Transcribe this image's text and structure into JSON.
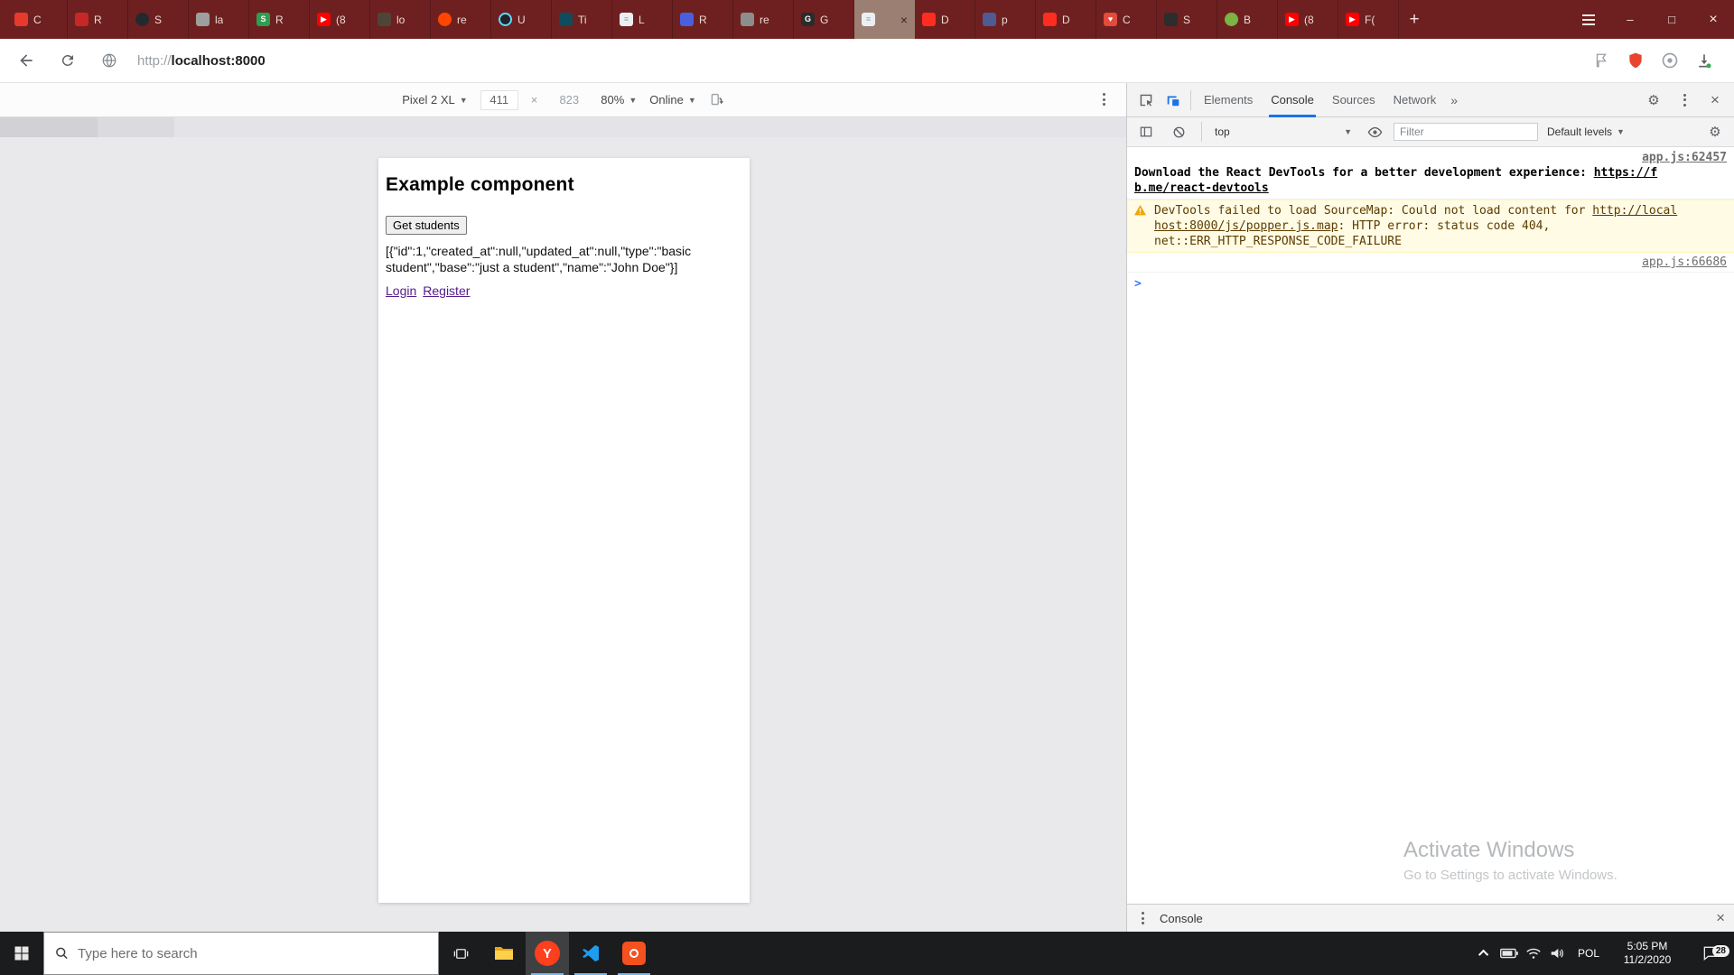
{
  "browser": {
    "new_tab": "+",
    "window": {
      "minimize": "–",
      "maximize": "□",
      "close": "×"
    },
    "address": {
      "protocol": "http://",
      "host": "localhost:8000"
    },
    "tabs": [
      {
        "title": "C",
        "color": "#e8392e",
        "glyph": "",
        "shape": "square"
      },
      {
        "title": "R",
        "color": "#c62828",
        "glyph": "",
        "shape": "square"
      },
      {
        "title": "S",
        "color": "#24292e",
        "glyph": "",
        "shape": "circle"
      },
      {
        "title": "la",
        "color": "#9e9e9e",
        "glyph": "",
        "shape": "square"
      },
      {
        "title": "R",
        "color": "#2e9e4f",
        "glyph": "S",
        "shape": "square"
      },
      {
        "title": "(8",
        "color": "#ff0000",
        "glyph": "▶",
        "shape": "square"
      },
      {
        "title": "lo",
        "color": "#4e4539",
        "glyph": "",
        "shape": "square"
      },
      {
        "title": "re",
        "color": "#ff4500",
        "glyph": "",
        "shape": "circle"
      },
      {
        "title": "U",
        "color": "#20232a",
        "glyph": "",
        "shape": "circle",
        "ring": "#61dafb"
      },
      {
        "title": "Ti",
        "color": "#0f4c5c",
        "glyph": "",
        "shape": "square"
      },
      {
        "title": "L",
        "color": "#eceff1",
        "glyph": "≡",
        "shape": "square",
        "fg": "#90a4ae"
      },
      {
        "title": "R",
        "color": "#4a5fe0",
        "glyph": "",
        "shape": "square"
      },
      {
        "title": "re",
        "color": "#8d8d8d",
        "glyph": "",
        "shape": "square"
      },
      {
        "title": "G",
        "color": "#2b2b2b",
        "glyph": "G",
        "shape": "square"
      },
      {
        "title": "",
        "color": "#eceff1",
        "glyph": "≡",
        "shape": "square",
        "fg": "#90a4ae",
        "active": true
      },
      {
        "title": "D",
        "color": "#ff2d20",
        "glyph": "",
        "shape": "square"
      },
      {
        "title": "p",
        "color": "#4f5b93",
        "glyph": "",
        "shape": "square"
      },
      {
        "title": "D",
        "color": "#ff2d20",
        "glyph": "",
        "shape": "square"
      },
      {
        "title": "C",
        "color": "#e64a3b",
        "glyph": "♥",
        "shape": "square"
      },
      {
        "title": "S",
        "color": "#2d2d2d",
        "glyph": "",
        "shape": "square"
      },
      {
        "title": "B",
        "color": "#7cb342",
        "glyph": "",
        "shape": "circle"
      },
      {
        "title": "(8",
        "color": "#ff0000",
        "glyph": "▶",
        "shape": "square"
      },
      {
        "title": "F(",
        "color": "#ff0000",
        "glyph": "▶",
        "shape": "square"
      }
    ]
  },
  "device_toolbar": {
    "device": "Pixel 2 XL",
    "width": "411",
    "sep": "×",
    "height": "823",
    "zoom": "80%",
    "throttle": "Online"
  },
  "page": {
    "heading": "Example component",
    "button_label": "Get students",
    "json_line1": "[{\"id\":1,\"created_at\":null,\"updated_at\":null,\"type\":\"basic",
    "json_line2": "student\",\"base\":\"just a student\",\"name\":\"John Doe\"}]",
    "link_login": "Login",
    "link_register": "Register"
  },
  "devtools": {
    "tabs": {
      "elements": "Elements",
      "console": "Console",
      "sources": "Sources",
      "network": "Network",
      "more": "»"
    },
    "toolbar": {
      "context": "top",
      "filter_placeholder": "Filter",
      "levels": "Default levels"
    },
    "msg_react": {
      "text": "Download the React DevTools for a better development experience: ",
      "link_line1": "https://f",
      "link_line2": "b.me/react-devtools",
      "source": "app.js:62457"
    },
    "msg_warning": {
      "line1_text": "DevTools failed to load SourceMap: Could not load content for ",
      "line1_link": "http://local",
      "line2_link": "host:8000/js/popper.js.map",
      "line2_text": ": HTTP error: status code 404,",
      "line3_text": "net::ERR_HTTP_RESPONSE_CODE_FAILURE",
      "source": "app.js:66686"
    },
    "prompt": ">",
    "drawer_label": "Console"
  },
  "watermark": {
    "line1": "Activate Windows",
    "line2": "Go to Settings to activate Windows."
  },
  "taskbar": {
    "search_placeholder": "Type here to search",
    "language": "POL",
    "time": "5:05 PM",
    "date": "11/2/2020",
    "badge": "28"
  },
  "colors": {
    "accent_blue": "#1a73e8",
    "warning_bg": "#fffbe5",
    "warning_text": "#5c3c00",
    "tab_strip": "#6e2020",
    "taskbar": "#1b1c1e",
    "yandex_red": "#fc3f1d"
  }
}
